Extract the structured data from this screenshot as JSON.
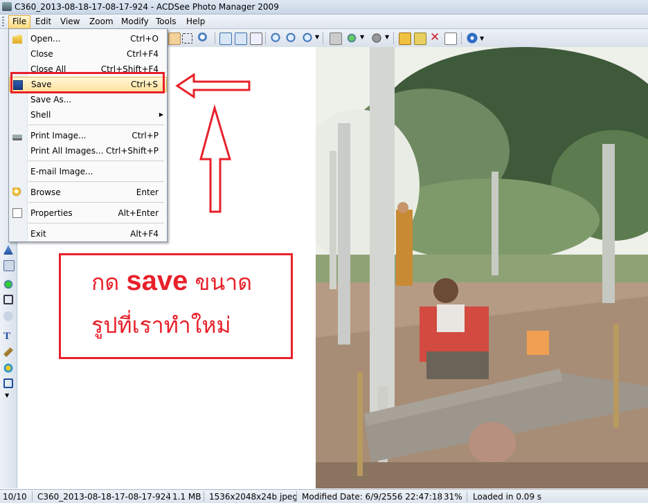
{
  "window": {
    "title": "C360_2013-08-18-17-08-17-924 - ACDSee Photo Manager 2009"
  },
  "menubar": {
    "items": [
      "File",
      "Edit",
      "View",
      "Zoom",
      "Modify",
      "Tools",
      "Help"
    ]
  },
  "file_menu": {
    "items": [
      {
        "label": "Open...",
        "shortcut": "Ctrl+O",
        "icon": "folder-open-icon"
      },
      {
        "label": "Close",
        "shortcut": "Ctrl+F4"
      },
      {
        "label": "Close All",
        "shortcut": "Ctrl+Shift+F4"
      },
      {
        "label": "Save",
        "shortcut": "Ctrl+S",
        "icon": "floppy-disk-icon",
        "highlighted": true
      },
      {
        "label": "Save As...",
        "shortcut": ""
      },
      {
        "label": "Shell",
        "shortcut": "",
        "submenu": true
      },
      {
        "label": "Print Image...",
        "shortcut": "Ctrl+P",
        "icon": "printer-icon"
      },
      {
        "label": "Print All Images...",
        "shortcut": "Ctrl+Shift+P"
      },
      {
        "label": "E-mail Image...",
        "shortcut": ""
      },
      {
        "label": "Browse",
        "shortcut": "Enter",
        "icon": "browse-icon"
      },
      {
        "label": "Properties",
        "shortcut": "Alt+Enter",
        "icon": "properties-icon"
      },
      {
        "label": "Exit",
        "shortcut": "Alt+F4"
      }
    ]
  },
  "annotation": {
    "line1_prefix": "กด ",
    "line1_bold": "save",
    "line1_suffix": " ขนาด",
    "line2": "รูปที่เราทำใหม่",
    "color": "#e8202a"
  },
  "statusbar": {
    "index": "10/10",
    "filename": "C360_2013-08-18-17-08-17-924",
    "filesize": "1.1 MB",
    "dimensions": "1536x2048x24b jpeg",
    "modified": "Modified Date: 6/9/2556 22:47:18",
    "zoom": "31%",
    "loaded": "Loaded in 0.09 s"
  }
}
